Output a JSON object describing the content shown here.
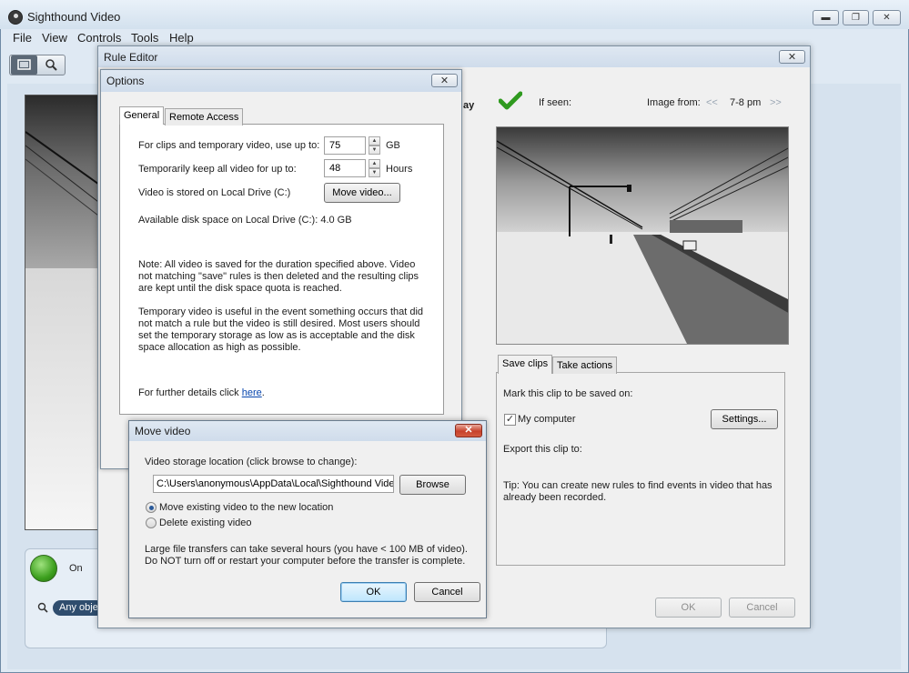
{
  "app": {
    "title": "Sighthound Video",
    "window_controls": {
      "minimize": "▬",
      "restore": "❐",
      "close": "✕"
    },
    "menu": [
      "File",
      "View",
      "Controls",
      "Tools",
      "Help"
    ]
  },
  "main": {
    "camera_status": "On",
    "object_filter": "Any obje"
  },
  "rule_editor": {
    "title": "Rule Editor",
    "close": "✕",
    "partial_label": "ay",
    "if_seen": "If seen:",
    "image_from_label": "Image from:",
    "prev": "<<",
    "time_range": "7-8 pm",
    "next": ">>",
    "tabs": [
      "Save clips",
      "Take actions"
    ],
    "mark_clip_label": "Mark this clip to be saved on:",
    "my_computer_label": "My computer",
    "my_computer_checked": true,
    "settings_button": "Settings...",
    "export_label": "Export this clip to:",
    "tip": "Tip: You can create new rules to find events in video that has already been recorded.",
    "ok": "OK",
    "cancel": "Cancel"
  },
  "options": {
    "title": "Options",
    "close": "✕",
    "tabs": [
      "General",
      "Remote Access"
    ],
    "clips_label": "For clips and temporary video, use up to:",
    "clips_value": "75",
    "clips_unit": "GB",
    "keep_label": "Temporarily keep all video for up to:",
    "keep_value": "48",
    "keep_unit": "Hours",
    "stored_label": "Video is stored on Local Drive (C:)",
    "move_button": "Move video...",
    "disk_space": "Available disk space on Local Drive (C:): 4.0 GB",
    "note": "Note: All video is saved for the duration specified above. Video not matching \"save\" rules is then deleted and the resulting clips are kept until the disk space quota is reached.",
    "temp_note": "Temporary video is useful in the event something occurs that did not match a rule but the video is still desired. Most users should set the temporary storage as low as is acceptable and the disk space allocation as high as possible.",
    "further_prefix": "For further details click ",
    "further_link": "here",
    "further_suffix": "."
  },
  "move_video": {
    "title": "Move video",
    "close": "✕",
    "location_label": "Video storage location (click browse to change):",
    "path": "C:\\Users\\anonymous\\AppData\\Local\\Sighthound Video",
    "browse": "Browse",
    "option_move": "Move existing video to the new location",
    "option_delete": "Delete existing video",
    "selected_option": "move",
    "warning": "Large file transfers can take several hours (you have < 100 MB of video). Do NOT turn off or restart your computer before the transfer is complete.",
    "ok": "OK",
    "cancel": "Cancel"
  }
}
